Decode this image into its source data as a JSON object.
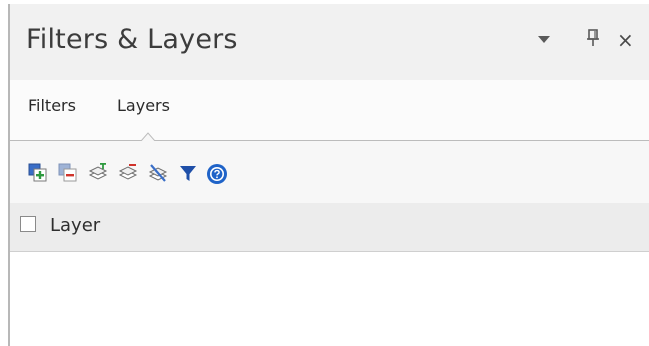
{
  "window": {
    "title": "Filters & Layers",
    "controls": [
      "chevron-down-icon",
      "pin-icon",
      "close-icon"
    ],
    "close_glyph": "×"
  },
  "tabs": [
    {
      "label": "Filters",
      "active": false
    },
    {
      "label": "Layers",
      "active": true
    }
  ],
  "toolbar": {
    "icons": [
      "add-layer-icon",
      "remove-layer-icon",
      "add-to-layer-icon",
      "remove-from-layer-icon",
      "clear-layer-icon",
      "filter-icon",
      "help-icon"
    ]
  },
  "grid": {
    "columns": [
      {
        "label": "Layer",
        "checked": false
      }
    ],
    "rows": []
  },
  "colors": {
    "accent_blue": "#1f63c8",
    "accent_red": "#d0342c",
    "accent_green": "#2e9a3f",
    "titlebar_bg": "#f1f1f1",
    "header_bg": "#ececec"
  }
}
